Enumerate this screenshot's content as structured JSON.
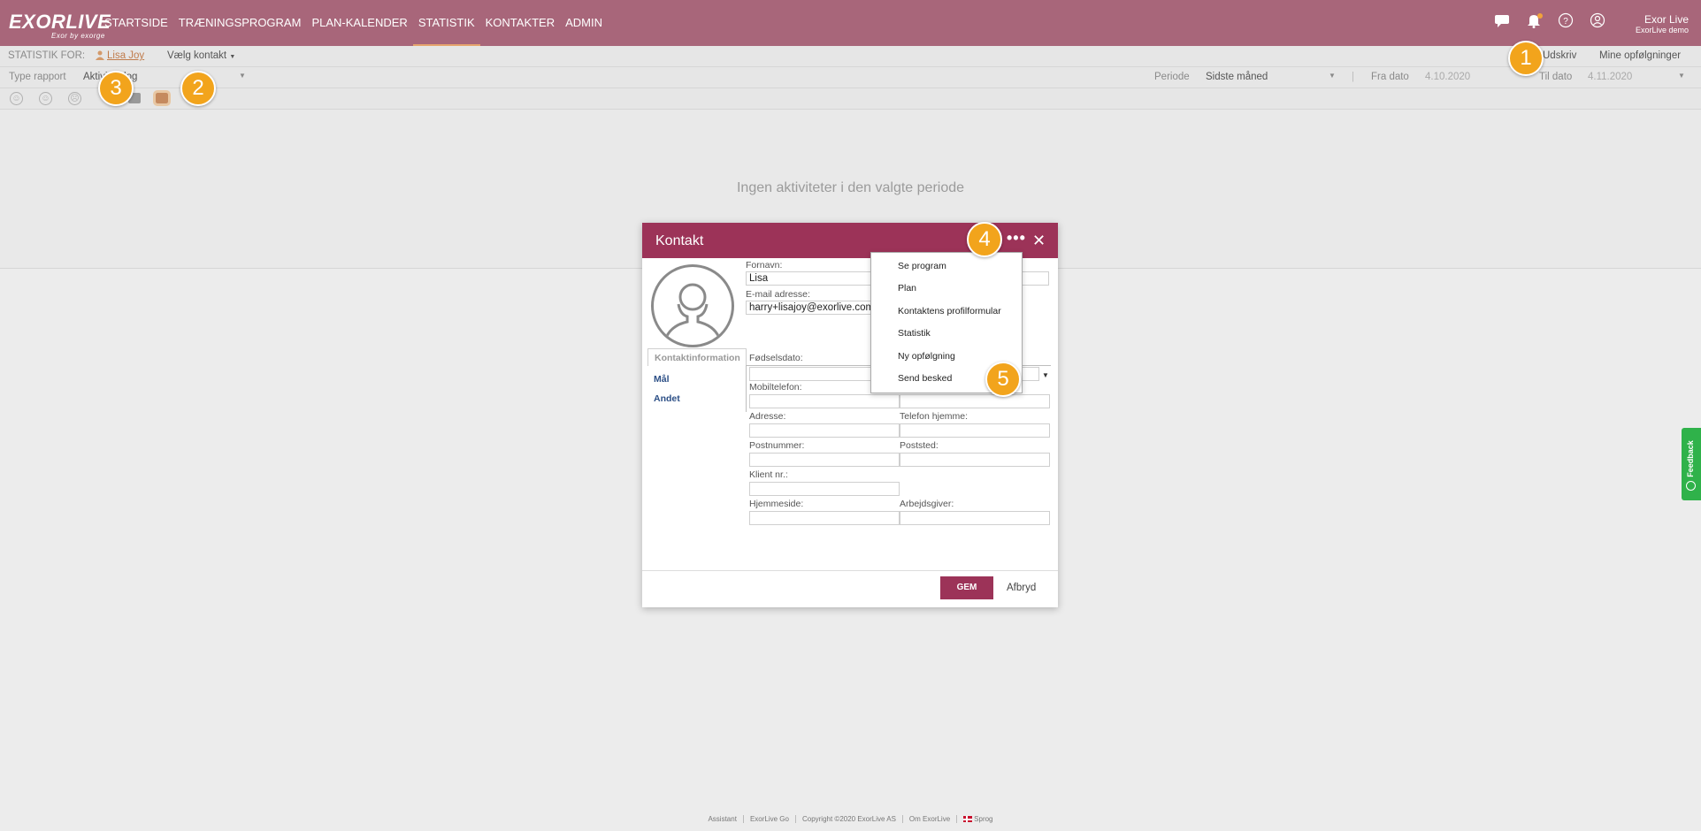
{
  "nav": {
    "logo": "EXORLIVE",
    "logo_tagline": "Exor by exorge",
    "items": [
      "STARTSIDE",
      "TRÆNINGSPROGRAM",
      "PLAN-KALENDER",
      "STATISTIK",
      "KONTAKTER",
      "ADMIN"
    ],
    "active": "STATISTIK",
    "icons": [
      "chat-icon",
      "bell-icon",
      "help-icon",
      "user-icon"
    ]
  },
  "user": {
    "name": "Exor Live",
    "org": "ExorLive demo"
  },
  "statbar": {
    "statistik_for_label": "STATISTIK FOR:",
    "contact_name": "Lisa Joy",
    "select_contact": "Vælg kontakt",
    "print": "Udskriv",
    "followups": "Mine opfølgninger"
  },
  "reportbar": {
    "type_label": "Type rapport",
    "type_value": "Aktivitetslog",
    "period_label": "Periode",
    "period_value": "Sidste måned",
    "from_label": "Fra dato",
    "from_value": "4.10.2020",
    "to_label": "Til dato",
    "to_value": "4.11.2020"
  },
  "empty_message": "Ingen aktiviteter i den valgte periode",
  "modal": {
    "title": "Kontakt",
    "firstname_label": "Fornavn:",
    "firstname_value": "Lisa",
    "email_label": "E-mail adresse:",
    "email_value": "harry+lisajoy@exorlive.com",
    "tabs": [
      "Kontaktinformation",
      "Mål",
      "Andet"
    ],
    "fields": {
      "birth": "Fødselsdato:",
      "mobile": "Mobiltelefon:",
      "address": "Adresse:",
      "phone_home": "Telefon hjemme:",
      "postal": "Postnummer:",
      "city": "Poststed:",
      "client_no": "Klient nr.:",
      "homepage": "Hjemmeside:",
      "employer": "Arbejdsgiver:"
    },
    "save": "GEM",
    "cancel": "Afbryd"
  },
  "menu": {
    "items": [
      "Se program",
      "Plan",
      "Kontaktens profilformular",
      "Statistik",
      "Ny opfølgning",
      "Send besked"
    ]
  },
  "badges": [
    "1",
    "2",
    "3",
    "4",
    "5"
  ],
  "footer": [
    "Assistant",
    "ExorLive Go",
    "Copyright ©2020 ExorLive AS",
    "Om ExorLive",
    "Sprog"
  ],
  "feedback": "Feedback",
  "colors": {
    "topbar": "#a8667a",
    "modal_header": "#9c3358",
    "badge": "#f2a41c",
    "feedback": "#2fb24a"
  }
}
